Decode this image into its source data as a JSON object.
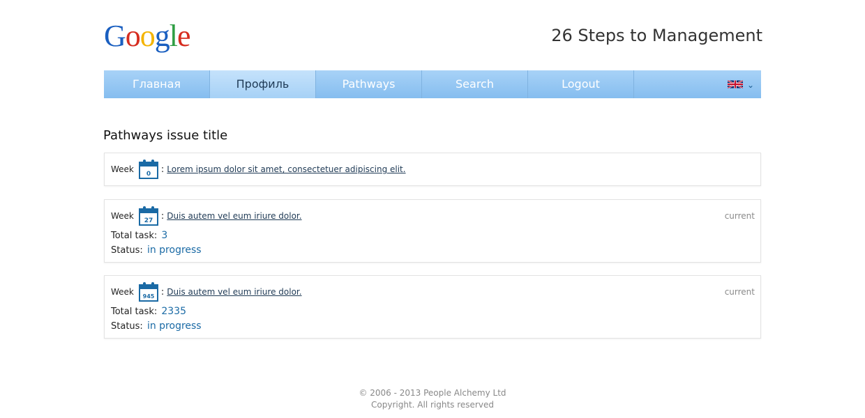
{
  "header": {
    "logo_letters": [
      {
        "ch": "G",
        "color": "#1a5fc0"
      },
      {
        "ch": "o",
        "color": "#d62d20"
      },
      {
        "ch": "o",
        "color": "#f4b400"
      },
      {
        "ch": "g",
        "color": "#1a5fc0"
      },
      {
        "ch": "l",
        "color": "#2f9e44"
      },
      {
        "ch": "e",
        "color": "#d62d20"
      }
    ],
    "site_title": "26 Steps to Management"
  },
  "nav": {
    "items": [
      {
        "label": "Главная",
        "active": false
      },
      {
        "label": "Профиль",
        "active": true
      },
      {
        "label": "Pathways",
        "active": false
      },
      {
        "label": "Search",
        "active": false
      },
      {
        "label": "Logout",
        "active": false
      }
    ],
    "language_icon": "uk-flag-icon"
  },
  "page": {
    "title": "Pathways issue title"
  },
  "weeks": [
    {
      "week_label": "Week",
      "week_number": "0",
      "colon": ":",
      "issue_title": "Lorem ipsum dolor sit amet, consectetuer adipiscing elit."
    },
    {
      "week_label": "Week",
      "week_number": "27",
      "colon": ":",
      "issue_title": "Duis autem vel eum iriure dolor.",
      "current_label": "current",
      "total_task_label": "Total task:",
      "total_task_value": "3",
      "status_label": "Status:",
      "status_value": "in progress"
    },
    {
      "week_label": "Week",
      "week_number": "945",
      "colon": ":",
      "issue_title": "Duis autem vel eum iriure dolor.",
      "current_label": "current",
      "total_task_label": "Total task:",
      "total_task_value": "2335",
      "status_label": "Status:",
      "status_value": "in progress"
    }
  ],
  "footer": {
    "line1": "© 2006 - 2013 People Alchemy Ltd",
    "line2": "Copyright. All rights reserved"
  },
  "colors": {
    "nav_bg": "#96c8f3",
    "link": "#1f3a55",
    "accent_value": "#1a6aa5",
    "calendar_icon": "#1a6aa5"
  }
}
